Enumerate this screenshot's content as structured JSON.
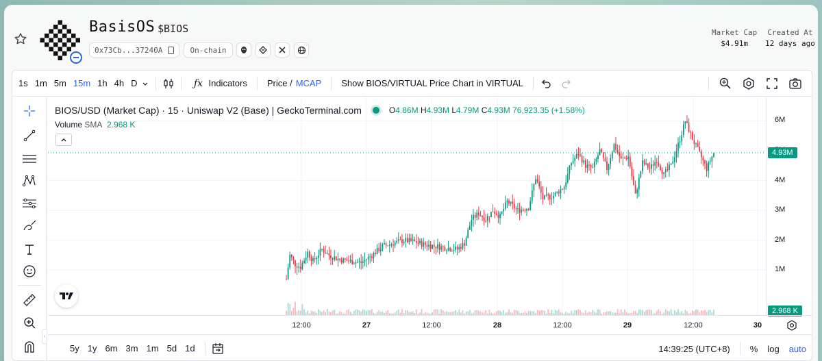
{
  "header": {
    "token_name": "BasisOS",
    "token_symbol": "$BIOS",
    "address": "0x73Cb...37240A",
    "chain_tag": "On-chain",
    "stats": [
      {
        "label": "Market Cap",
        "value": "$4.91m"
      },
      {
        "label": "Created At",
        "value": "12 days ago"
      }
    ]
  },
  "toolbar": {
    "timeframes": [
      "1s",
      "1m",
      "5m",
      "15m",
      "1h",
      "4h",
      "D"
    ],
    "active_timeframe": "15m",
    "indicators_label": "Indicators",
    "price_label": "Price /",
    "mcap_label": "MCAP",
    "compare_label": "Show BIOS/VIRTUAL Price Chart in VIRTUAL"
  },
  "legend": {
    "title": "BIOS/USD (Market Cap) · 15 · Uniswap V2 (Base) | GeckoTerminal.com",
    "o": "4.86M",
    "h": "4.93M",
    "l": "4.79M",
    "c": "4.93M",
    "change": "76,923.35 (+1.58%)",
    "volume_label": "Volume",
    "sma_label": "SMA",
    "volume_value": "2.968 K"
  },
  "axis": {
    "y_ticks": [
      "6M",
      "5M",
      "4M",
      "3M",
      "2M",
      "1M"
    ],
    "last_price": "4.93M",
    "last_volume": "2.968 K",
    "x_ticks": [
      "12:00",
      "27",
      "12:00",
      "28",
      "12:00",
      "29",
      "12:00",
      "30"
    ]
  },
  "bottom": {
    "ranges": [
      "5y",
      "1y",
      "6m",
      "3m",
      "1m",
      "5d",
      "1d"
    ],
    "time": "14:39:25 (UTC+8)",
    "percent": "%",
    "log": "log",
    "auto": "auto"
  },
  "colors": {
    "up": "#089981",
    "down": "#f23645",
    "accent": "#2962ff"
  },
  "chart_data": {
    "type": "candlestick",
    "title": "BIOS/USD (Market Cap) · 15 · Uniswap V2 (Base) | GeckoTerminal.com",
    "ylim": [
      0,
      6500000
    ],
    "y_ticks": [
      1000000,
      2000000,
      3000000,
      4000000,
      5000000,
      6000000
    ],
    "x_ticks": [
      "12:00",
      "27",
      "12:00",
      "28",
      "12:00",
      "29",
      "12:00",
      "30"
    ],
    "series": [
      {
        "name": "Market Cap",
        "close_path": [
          [
            0,
            0.7
          ],
          [
            2,
            1.5
          ],
          [
            5,
            1.2
          ],
          [
            8,
            1.1
          ],
          [
            12,
            1.6
          ],
          [
            15,
            1.3
          ],
          [
            20,
            1.7
          ],
          [
            24,
            1.5
          ],
          [
            30,
            1.35
          ],
          [
            36,
            1.3
          ],
          [
            42,
            1.25
          ],
          [
            48,
            1.5
          ],
          [
            54,
            1.8
          ],
          [
            60,
            1.9
          ],
          [
            66,
            2.0
          ],
          [
            72,
            1.95
          ],
          [
            78,
            1.85
          ],
          [
            84,
            1.8
          ],
          [
            90,
            1.75
          ],
          [
            96,
            1.7
          ],
          [
            100,
            1.9
          ],
          [
            104,
            2.7
          ],
          [
            108,
            2.9
          ],
          [
            112,
            2.7
          ],
          [
            116,
            3.0
          ],
          [
            120,
            2.8
          ],
          [
            124,
            3.3
          ],
          [
            130,
            3.0
          ],
          [
            136,
            3.1
          ],
          [
            140,
            4.1
          ],
          [
            144,
            3.4
          ],
          [
            150,
            3.5
          ],
          [
            156,
            3.8
          ],
          [
            160,
            4.6
          ],
          [
            164,
            4.9
          ],
          [
            168,
            4.5
          ],
          [
            172,
            4.4
          ],
          [
            176,
            5.0
          ],
          [
            180,
            4.4
          ],
          [
            184,
            5.2
          ],
          [
            188,
            4.7
          ],
          [
            192,
            4.8
          ],
          [
            196,
            3.5
          ],
          [
            200,
            4.6
          ],
          [
            204,
            4.4
          ],
          [
            208,
            4.7
          ],
          [
            212,
            4.2
          ],
          [
            216,
            4.5
          ],
          [
            220,
            5.2
          ],
          [
            224,
            6.0
          ],
          [
            228,
            5.4
          ],
          [
            232,
            4.9
          ],
          [
            236,
            4.4
          ],
          [
            240,
            4.93
          ]
        ]
      }
    ],
    "last_close": 4930000,
    "last_change_pct": 1.58
  }
}
